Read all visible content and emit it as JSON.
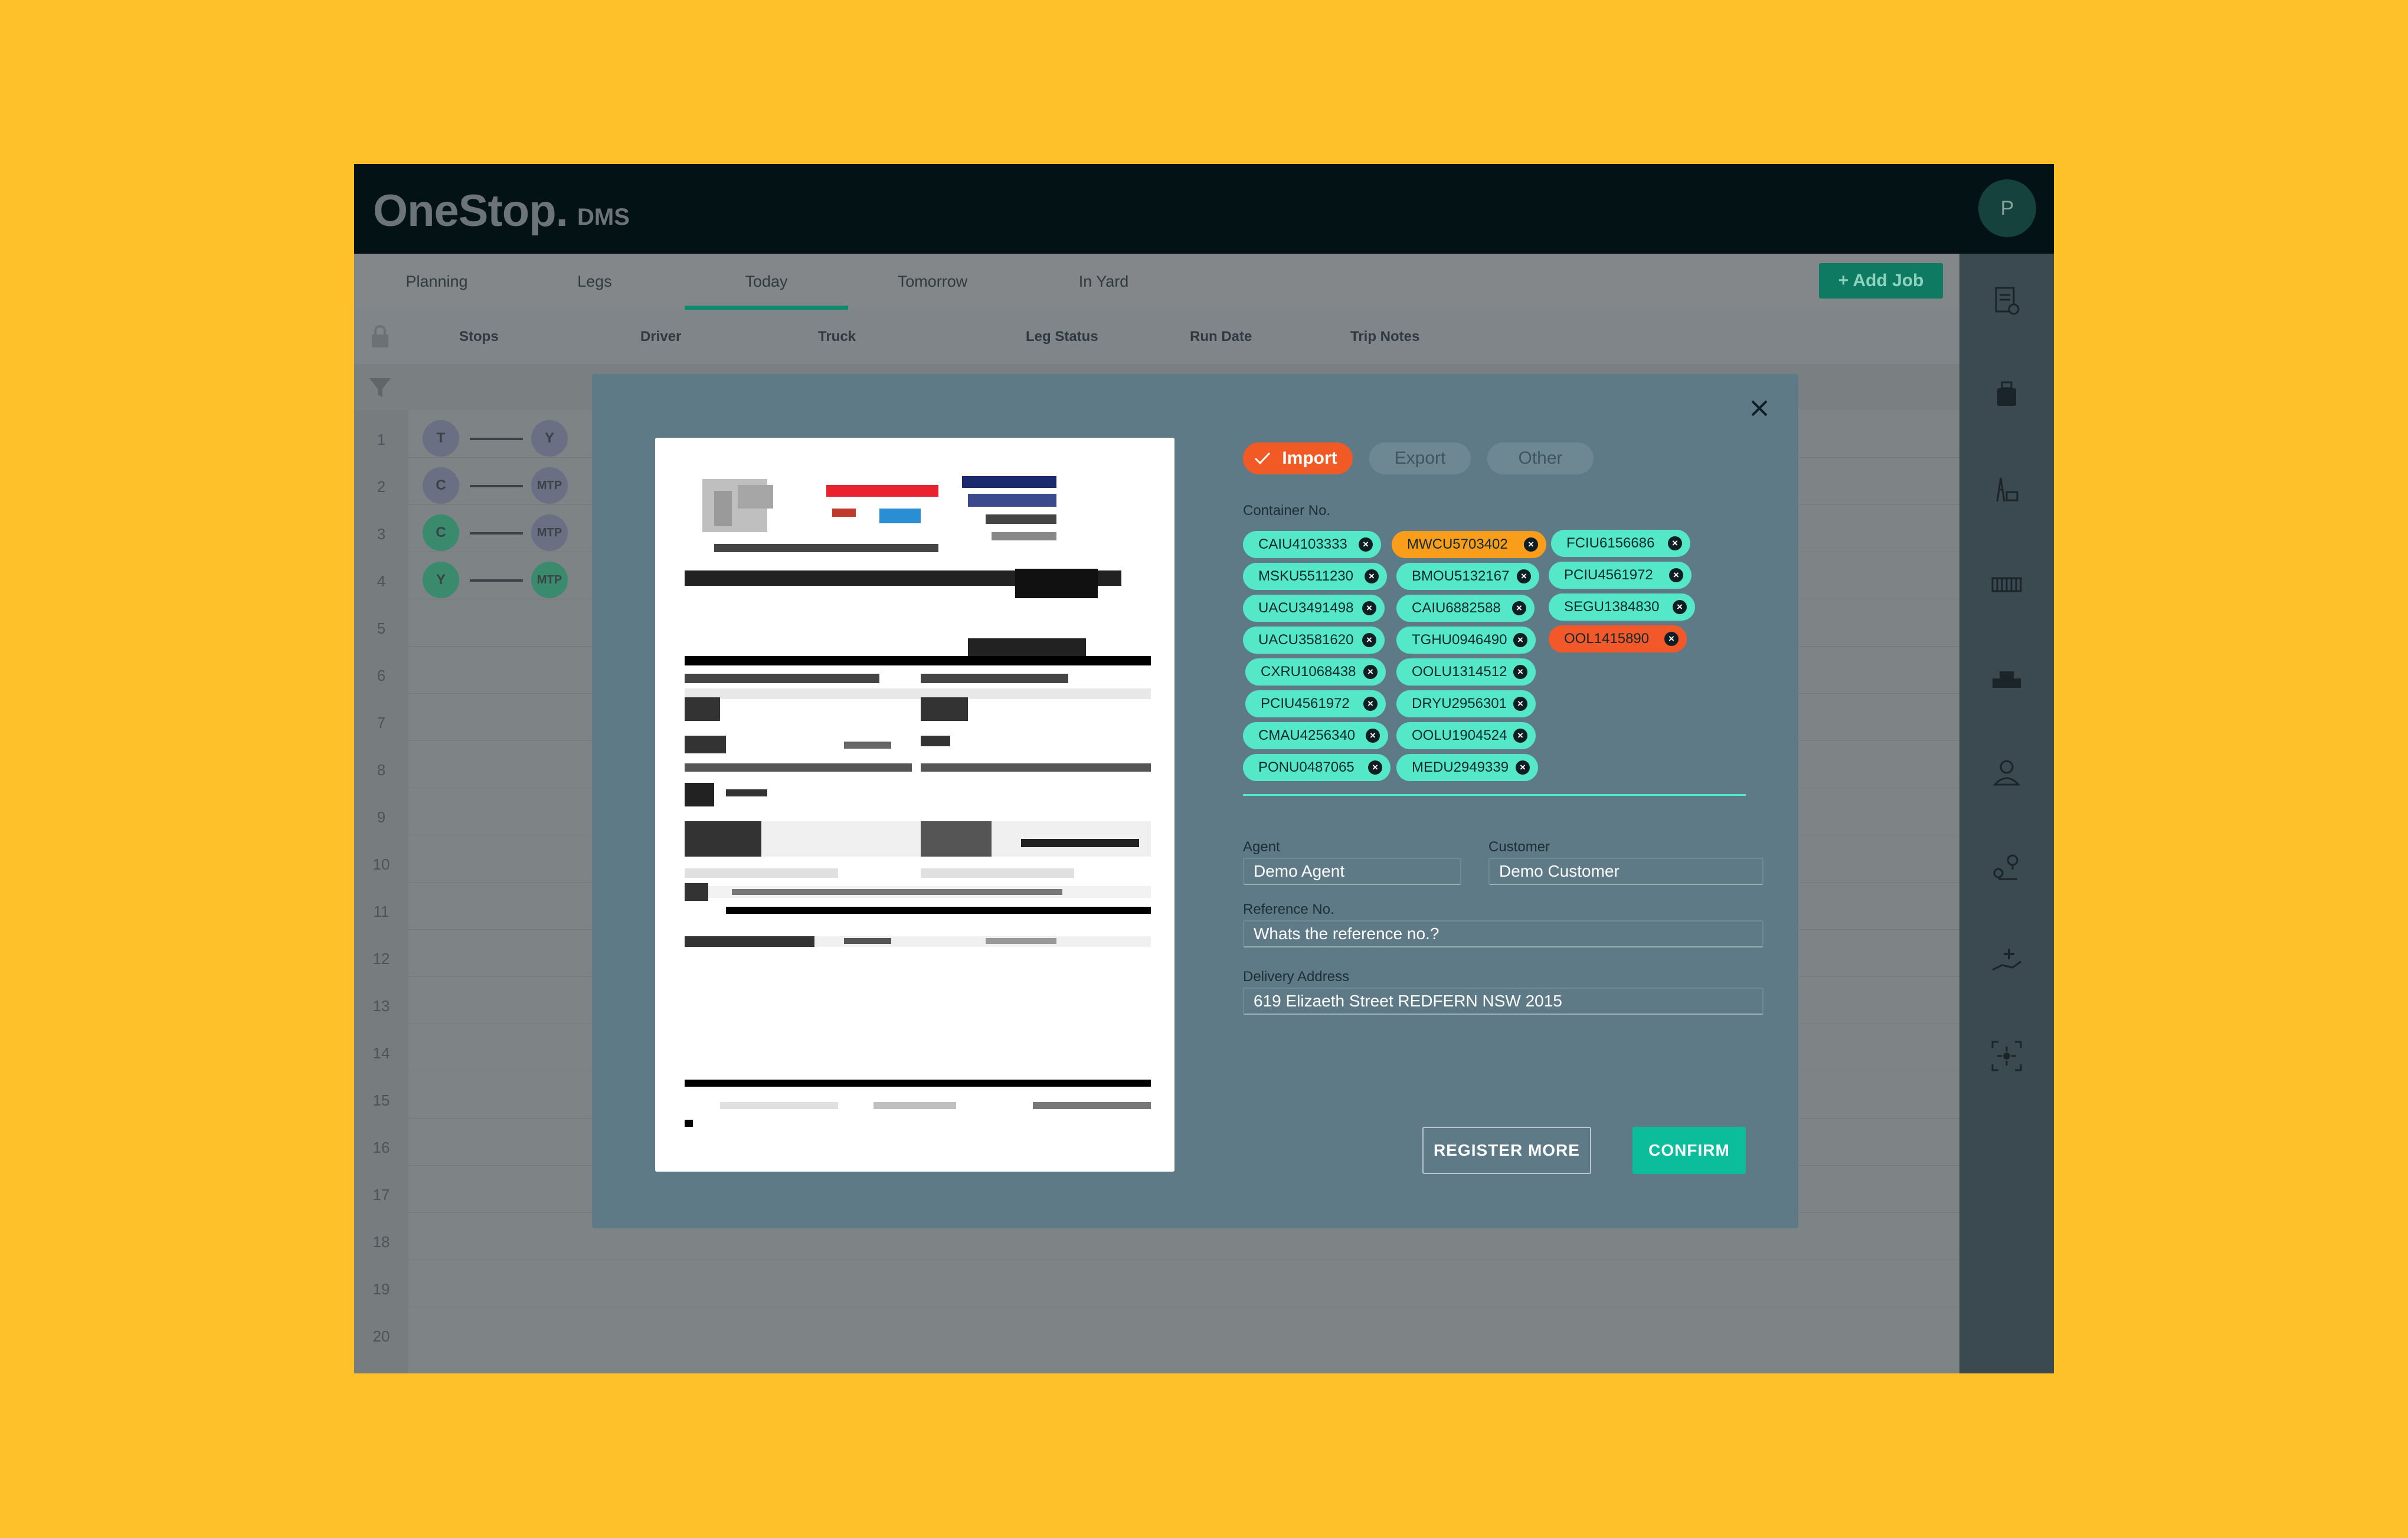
{
  "app": {
    "logo": "OneStop",
    "logo_dot": ".",
    "product": "DMS",
    "avatar_initial": "P"
  },
  "tabs": [
    "Planning",
    "Legs",
    "Today",
    "Tomorrow",
    "In Yard"
  ],
  "active_tab": "Today",
  "add_job_label": "+ Add Job",
  "columns": [
    "Stops",
    "Driver",
    "Truck",
    "Leg Status",
    "Run Date",
    "Trip Notes"
  ],
  "rows": [
    {
      "num": "1",
      "from": "T",
      "to": "Y"
    },
    {
      "num": "2",
      "from": "C",
      "to": "MTP"
    },
    {
      "num": "3",
      "from": "C",
      "to": "MTP"
    },
    {
      "num": "4",
      "from": "Y",
      "to": "MTP"
    },
    {
      "num": "5"
    },
    {
      "num": "6"
    },
    {
      "num": "7"
    },
    {
      "num": "8"
    },
    {
      "num": "9"
    },
    {
      "num": "10"
    },
    {
      "num": "11"
    },
    {
      "num": "12"
    },
    {
      "num": "13"
    },
    {
      "num": "14"
    },
    {
      "num": "15"
    },
    {
      "num": "16"
    },
    {
      "num": "17"
    },
    {
      "num": "18"
    },
    {
      "num": "19"
    },
    {
      "num": "20"
    }
  ],
  "modal": {
    "type_options": [
      "Import",
      "Export",
      "Other"
    ],
    "selected_type": "Import",
    "container_label": "Container No.",
    "containers": [
      {
        "id": "CAIU4103333",
        "status": "ok"
      },
      {
        "id": "MWCU5703402",
        "status": "warning"
      },
      {
        "id": "FCIU6156686",
        "status": "ok"
      },
      {
        "id": "MSKU5511230",
        "status": "ok"
      },
      {
        "id": "BMOU5132167",
        "status": "ok"
      },
      {
        "id": "PCIU4561972",
        "status": "ok"
      },
      {
        "id": "UACU3491498",
        "status": "ok"
      },
      {
        "id": "CAIU6882588",
        "status": "ok"
      },
      {
        "id": "SEGU1384830",
        "status": "ok"
      },
      {
        "id": "UACU3581620",
        "status": "ok"
      },
      {
        "id": "TGHU0946490",
        "status": "ok"
      },
      {
        "id": "OOL1415890",
        "status": "error"
      },
      {
        "id": "CXRU1068438",
        "status": "ok"
      },
      {
        "id": "OOLU1314512",
        "status": "ok"
      },
      {
        "id": "PCIU4561972",
        "status": "ok"
      },
      {
        "id": "DRYU2956301",
        "status": "ok"
      },
      {
        "id": "CMAU4256340",
        "status": "ok"
      },
      {
        "id": "OOLU1904524",
        "status": "ok"
      },
      {
        "id": "PONU0487065",
        "status": "ok"
      },
      {
        "id": "MEDU2949339",
        "status": "ok"
      }
    ],
    "agent_label": "Agent",
    "agent_value": "Demo Agent",
    "customer_label": "Customer",
    "customer_value": "Demo Customer",
    "reference_label": "Reference No.",
    "reference_value": "Whats the reference no.?",
    "address_label": "Delivery Address",
    "address_value": "619 Elizaeth Street REDFERN NSW 2015",
    "register_more_label": "REGISTER MORE",
    "confirm_label": "CONFIRM"
  },
  "colors": {
    "background": "#FEC12A",
    "accent": "#0BBD9B",
    "chip_ok": "#55E8C8",
    "chip_warning": "#FA9D1A",
    "chip_error": "#F2582A",
    "type_selected": "#F15A24"
  },
  "icons": {
    "right_sidebar": [
      "document-icon",
      "container-icon",
      "crane-icon",
      "barcode-icon",
      "truck-icon",
      "driver-icon",
      "location-icon",
      "hand-plus-icon",
      "scan-icon"
    ],
    "close": "close-icon",
    "check": "check-icon",
    "chip_remove": "x-circle-icon"
  }
}
